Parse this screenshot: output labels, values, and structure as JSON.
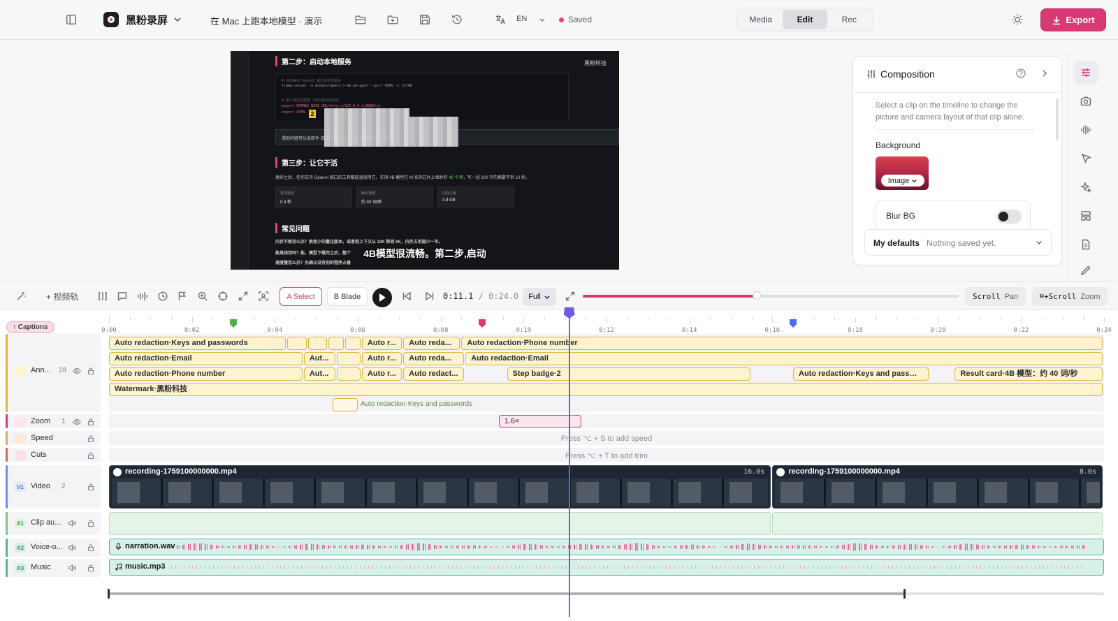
{
  "topbar": {
    "app_name": "黑粉录屏",
    "doc_title": "在 Mac 上跑本地模型 · 演示",
    "language": "EN",
    "save_status": "Saved",
    "modes": [
      {
        "label": "Media",
        "active": false
      },
      {
        "label": "Edit",
        "active": true
      },
      {
        "label": "Rec",
        "active": false
      }
    ],
    "export_label": "Export"
  },
  "preview": {
    "brand": "黑粉科技",
    "step2_heading": "第二步：启动本地服务",
    "code_lines": [
      "# 启动兼容 OpenAI 接口的本地服务",
      "llama-server -m models/qwen3.5-4b-q4.gguf --port 8080 -c 32768",
      "# 客户端这样配置（演示用的假密钥）",
      "export OPENAI_BASE_URL=http://127.0.0.1:8080/v1",
      "export OPEN"
    ],
    "badge_number": "2",
    "note_text": "遇到问题可以发邮件                  或拨打演示热线                  这两条都是演示数据。",
    "step3_heading": "第三步：让它干活",
    "step3_text_a": "接好之后，任何支持 OpenAI 接口的工具都能直接用它。实测 4B 模型在 M 系列芯片上每秒约 ",
    "step3_text_green": "40 个词",
    "step3_text_b": "，写一段 300 字的摘要不到 10 秒。",
    "stats": [
      {
        "label": "首字延迟",
        "value": "0.4 秒"
      },
      {
        "label": "解码速度",
        "value": "约 40 词/秒"
      },
      {
        "label": "内存占用",
        "value": "3.9 GB"
      }
    ],
    "faq_heading": "常见问题",
    "faq_lines": [
      "内存不够怎么办？换更小的量化版本，或者把上下文从 32K 降到 8K，内存占用能少一半。",
      "能离线用吗？能，模型下载完之后，整个"
    ],
    "faq_line3": "速度慢怎么办？先确认没有别的程序占着",
    "caption": "4B模型很流畅。第二步,启动"
  },
  "composition": {
    "title": "Composition",
    "description": "Select a clip on the timeline to change the picture and camera layout of that clip alone.",
    "background_label": "Background",
    "background_type": "Image",
    "blur_label": "Blur BG",
    "blur_enabled": false,
    "defaults_title": "My defaults",
    "defaults_status": "Nothing saved yet.",
    "accent": "#d93a75"
  },
  "toolbar": {
    "add_video_track": "+ 视频轨",
    "select_tool": "A Select",
    "blade_tool": "B Blade",
    "current_time": "0:11.1",
    "separator": "/",
    "duration": "0:24.0",
    "zoom_mode": "Full",
    "playhead_fraction": 0.463,
    "scroll_key": "Scroll",
    "scroll_action": "Pan",
    "zoom_key": "⌘+Scroll",
    "zoom_action": "Zoom"
  },
  "timeline": {
    "captions_label": "↑ Captions",
    "duration_seconds": 24,
    "ticks": [
      "0:00",
      "0:02",
      "0:04",
      "0:06",
      "0:08",
      "0:10",
      "0:12",
      "0:14",
      "0:16",
      "0:18",
      "0:20",
      "0:22",
      "0:24"
    ],
    "playhead_seconds": 11.1,
    "markers": [
      {
        "t": 3.0,
        "color": "#4caf50"
      },
      {
        "t": 9.0,
        "color": "#d93a75"
      },
      {
        "t": 16.5,
        "color": "#4a6cf7"
      }
    ],
    "tracks": [
      {
        "id": "ann",
        "name": "Ann...",
        "count": "28",
        "color": "#e2b53a",
        "badge": "",
        "badge_bg": "#fdf3cf",
        "badge_fg": "#c08a00"
      },
      {
        "id": "zoom",
        "name": "Zoom",
        "count": "1",
        "color": "#d93a75",
        "badge": "",
        "badge_bg": "#fbe5ee",
        "badge_fg": "#d93a75"
      },
      {
        "id": "speed",
        "name": "Speed",
        "count": "",
        "color": "#f0a060",
        "badge": "",
        "badge_bg": "#fde8d8",
        "badge_fg": "#e07a30"
      },
      {
        "id": "cuts",
        "name": "Cuts",
        "count": "",
        "color": "#e06060",
        "badge": "",
        "badge_bg": "#fbe0e0",
        "badge_fg": "#d04040"
      },
      {
        "id": "video",
        "name": "Video",
        "count": "2",
        "color": "#6c8cf0",
        "badge": "V1",
        "badge_bg": "#e3e9fd",
        "badge_fg": "#4a6cf7"
      },
      {
        "id": "a1",
        "name": "Clip au...",
        "count": "",
        "color": "#7cc48a",
        "badge": "A1",
        "badge_bg": "#e1f3e4",
        "badge_fg": "#3f9a52"
      },
      {
        "id": "a2",
        "name": "Voice-o...",
        "count": "",
        "color": "#4fb3a0",
        "badge": "A2",
        "badge_bg": "#d8f0ea",
        "badge_fg": "#2f8f7c"
      },
      {
        "id": "a3",
        "name": "Music",
        "count": "",
        "color": "#4fb3a0",
        "badge": "A3",
        "badge_bg": "#d8f0ea",
        "badge_fg": "#2f8f7c"
      }
    ],
    "annotation_rows": [
      [
        {
          "start": 0.0,
          "end": 4.3,
          "label": "Auto redaction·Keys and passwords"
        },
        {
          "start": 4.3,
          "end": 4.8,
          "label": ""
        },
        {
          "start": 4.8,
          "end": 5.3,
          "label": ""
        },
        {
          "start": 5.3,
          "end": 5.7,
          "label": ""
        },
        {
          "start": 5.7,
          "end": 6.1,
          "label": ""
        },
        {
          "start": 6.1,
          "end": 7.1,
          "label": "Auto r..."
        },
        {
          "start": 7.1,
          "end": 8.5,
          "label": "Auto reda..."
        },
        {
          "start": 8.5,
          "end": 24.0,
          "label": "Auto redaction·Phone number"
        }
      ],
      [
        {
          "start": 0.0,
          "end": 4.7,
          "label": "Auto redaction·Email"
        },
        {
          "start": 4.7,
          "end": 5.5,
          "label": "Aut..."
        },
        {
          "start": 5.5,
          "end": 6.1,
          "label": ""
        },
        {
          "start": 6.1,
          "end": 7.1,
          "label": "Auto r..."
        },
        {
          "start": 7.1,
          "end": 8.6,
          "label": "Auto reda..."
        },
        {
          "start": 8.6,
          "end": 24.0,
          "label": "Auto redaction·Email"
        }
      ],
      [
        {
          "start": 0.0,
          "end": 4.7,
          "label": "Auto redaction·Phone number"
        },
        {
          "start": 4.7,
          "end": 5.5,
          "label": "Aut..."
        },
        {
          "start": 5.5,
          "end": 6.1,
          "label": ""
        },
        {
          "start": 6.1,
          "end": 7.1,
          "label": "Auto r..."
        },
        {
          "start": 7.1,
          "end": 8.6,
          "label": "Auto redact..."
        },
        {
          "start": 9.6,
          "end": 15.5,
          "label": "Step badge·2"
        },
        {
          "start": 16.5,
          "end": 19.8,
          "label": "Auto redaction·Keys and passwo..."
        },
        {
          "start": 20.4,
          "end": 24.0,
          "label": "Result card·4B 模型：约 40 词/秒"
        }
      ],
      [
        {
          "start": 0.0,
          "end": 24.0,
          "label": "Watermark·黑粉科技"
        }
      ]
    ],
    "ghost_clip": {
      "start": 5.4,
      "end": 6.0,
      "label": "Auto redaction·Keys and passwords"
    },
    "zoom_clip": {
      "start": 9.4,
      "end": 11.4,
      "label": "1.6×"
    },
    "speed_hint": "Press ⌥ + S to add speed",
    "cuts_hint": "Press ⌥ + T to add trim",
    "video_clips": [
      {
        "start": 0.0,
        "end": 16.0,
        "name": "recording-1759100000000.mp4",
        "duration_label": "16.0s"
      },
      {
        "start": 16.0,
        "end": 24.0,
        "name": "recording-1759100000000.mp4",
        "duration_label": "8.0s"
      }
    ],
    "audio_clips": {
      "voice": "narration.wav",
      "music": "music.mp3"
    },
    "scroll_fraction": 0.8
  }
}
